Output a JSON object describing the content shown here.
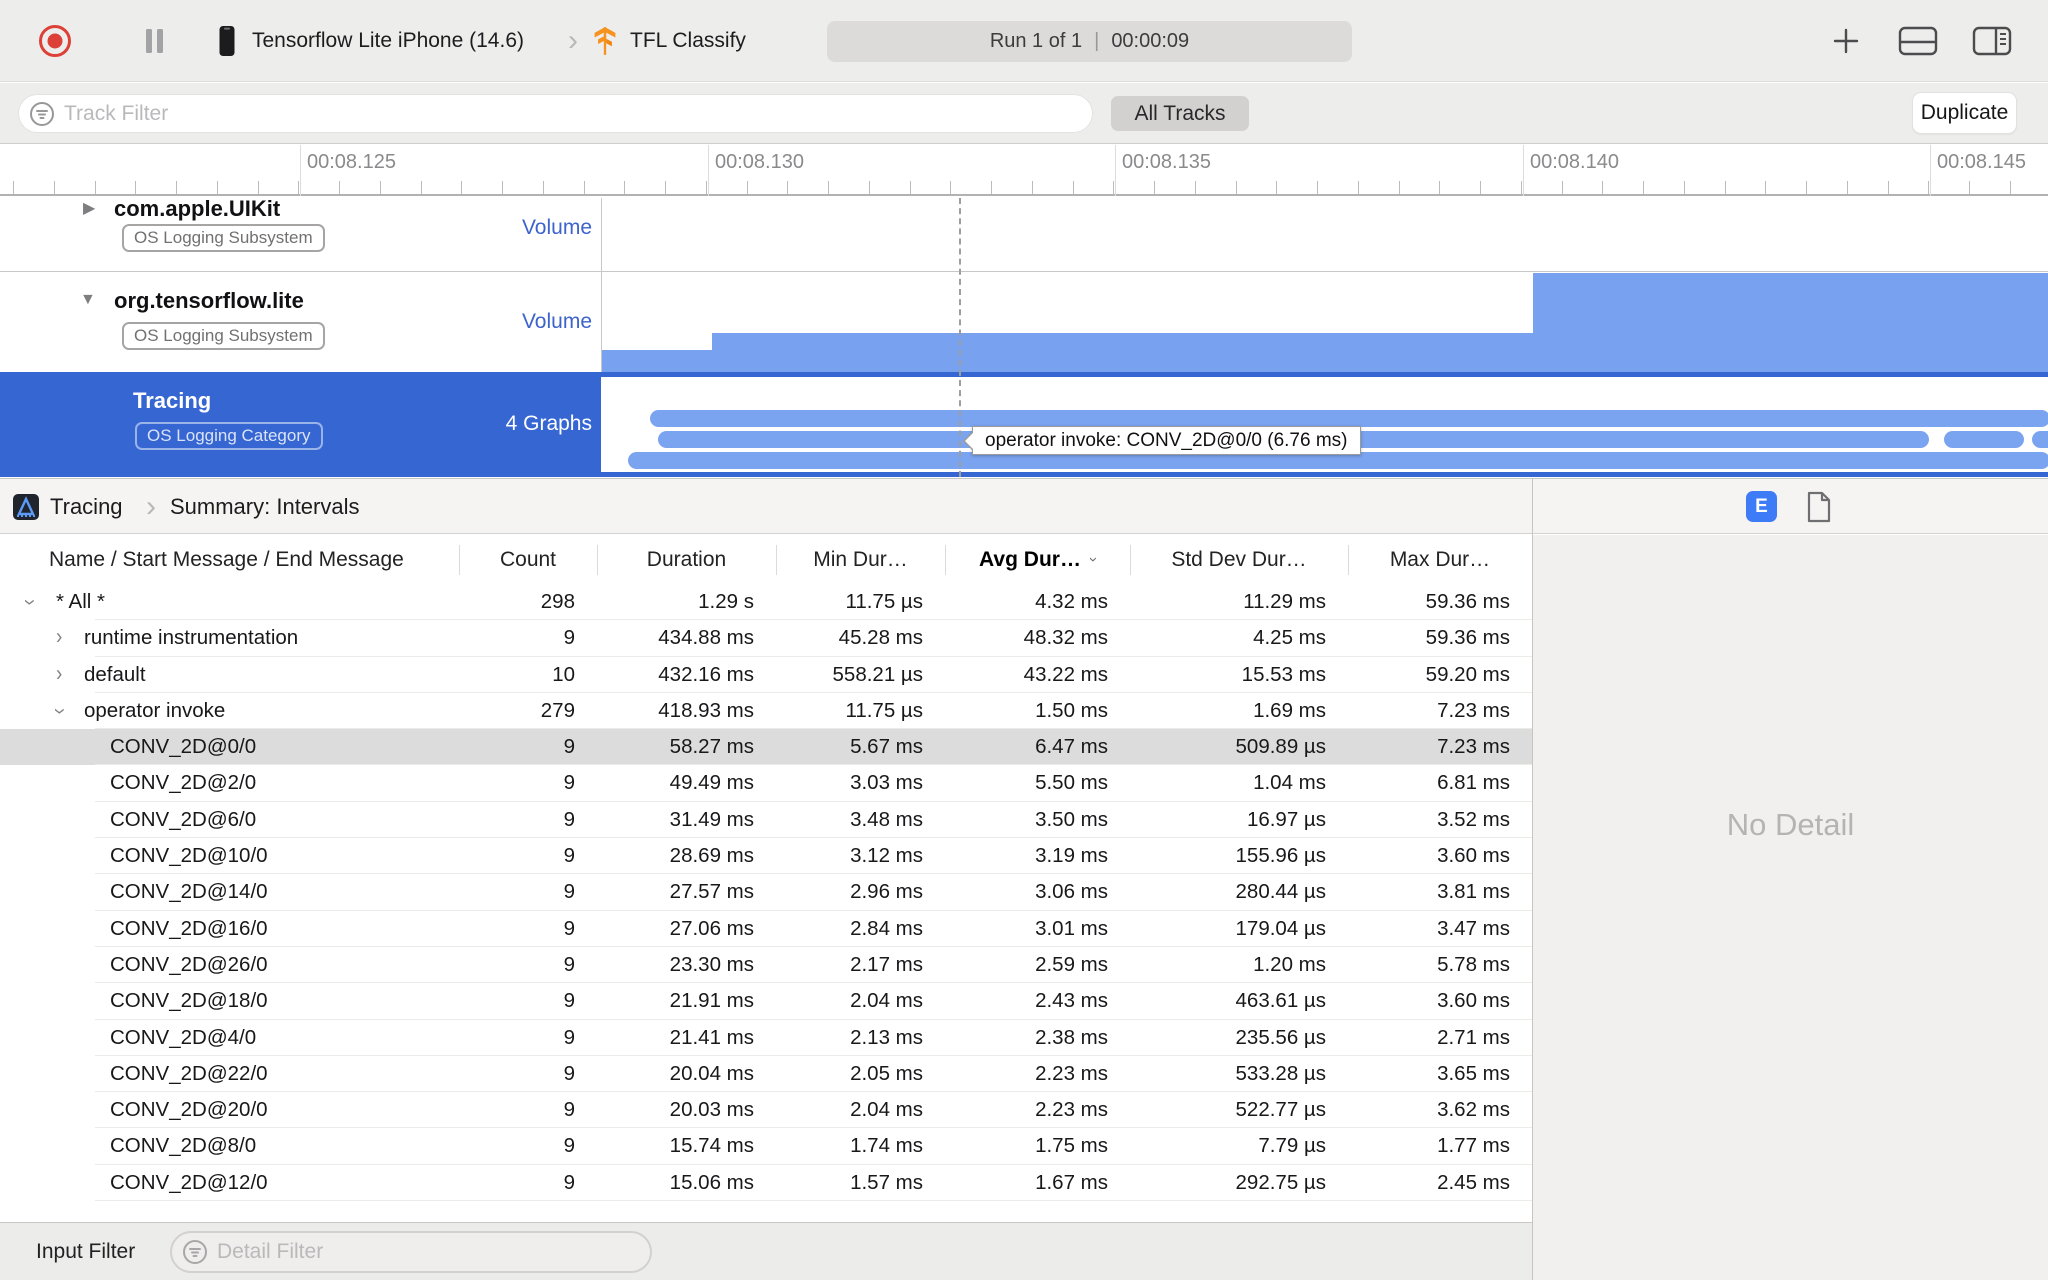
{
  "toolbar": {
    "device_breadcrumb": "Tensorflow Lite iPhone (14.6)",
    "target_app": "TFL Classify",
    "run_status": "Run 1 of 1",
    "run_separator": "|",
    "run_time": "00:00:09"
  },
  "filter_bar": {
    "track_filter_placeholder": "Track Filter",
    "all_tracks_label": "All Tracks",
    "duplicate_label": "Duplicate"
  },
  "ruler": {
    "labels": [
      "00:08.125",
      "00:08.130",
      "00:08.135",
      "00:08.140",
      "00:08.145"
    ]
  },
  "tracks": [
    {
      "title": "com.apple.UIKit",
      "badge": "OS Logging Subsystem",
      "meta": "Volume",
      "disclosure": "collapsed"
    },
    {
      "title": "org.tensorflow.lite",
      "badge": "OS Logging Subsystem",
      "meta": "Volume",
      "disclosure": "expanded"
    },
    {
      "title": "Tracing",
      "badge": "OS Logging Category",
      "meta": "4 Graphs",
      "disclosure": "none",
      "selected": true
    }
  ],
  "tooltip": {
    "text": "operator invoke: CONV_2D@0/0 (6.76 ms)"
  },
  "detail": {
    "breadcrumb": {
      "root": "Tracing",
      "page": "Summary: Intervals"
    },
    "view_toggle_label": "E",
    "no_detail": "No Detail",
    "bottom_label": "Input Filter",
    "bottom_placeholder": "Detail Filter"
  },
  "table": {
    "columns": [
      "Name / Start Message / End Message",
      "Count",
      "Duration",
      "Min Dur…",
      "Avg Dur…",
      "Std Dev Dur…",
      "Max Dur…"
    ],
    "sorted_column": "Avg Dur…",
    "rows": [
      {
        "level": 1,
        "disclosure": "expanded",
        "name": "* All *",
        "count": "298",
        "duration": "1.29 s",
        "min": "11.75 µs",
        "avg": "4.32 ms",
        "std": "11.29 ms",
        "max": "59.36 ms"
      },
      {
        "level": 2,
        "disclosure": "collapsed",
        "name": "runtime instrumentation",
        "count": "9",
        "duration": "434.88 ms",
        "min": "45.28 ms",
        "avg": "48.32 ms",
        "std": "4.25 ms",
        "max": "59.36 ms"
      },
      {
        "level": 2,
        "disclosure": "collapsed",
        "name": "default",
        "count": "10",
        "duration": "432.16 ms",
        "min": "558.21 µs",
        "avg": "43.22 ms",
        "std": "15.53 ms",
        "max": "59.20 ms"
      },
      {
        "level": 2,
        "disclosure": "expanded",
        "name": "operator invoke",
        "count": "279",
        "duration": "418.93 ms",
        "min": "11.75 µs",
        "avg": "1.50 ms",
        "std": "1.69 ms",
        "max": "7.23 ms"
      },
      {
        "level": 3,
        "disclosure": "none",
        "selected": true,
        "name": "CONV_2D@0/0",
        "count": "9",
        "duration": "58.27 ms",
        "min": "5.67 ms",
        "avg": "6.47 ms",
        "std": "509.89 µs",
        "max": "7.23 ms"
      },
      {
        "level": 3,
        "disclosure": "none",
        "name": "CONV_2D@2/0",
        "count": "9",
        "duration": "49.49 ms",
        "min": "3.03 ms",
        "avg": "5.50 ms",
        "std": "1.04 ms",
        "max": "6.81 ms"
      },
      {
        "level": 3,
        "disclosure": "none",
        "name": "CONV_2D@6/0",
        "count": "9",
        "duration": "31.49 ms",
        "min": "3.48 ms",
        "avg": "3.50 ms",
        "std": "16.97 µs",
        "max": "3.52 ms"
      },
      {
        "level": 3,
        "disclosure": "none",
        "name": "CONV_2D@10/0",
        "count": "9",
        "duration": "28.69 ms",
        "min": "3.12 ms",
        "avg": "3.19 ms",
        "std": "155.96 µs",
        "max": "3.60 ms"
      },
      {
        "level": 3,
        "disclosure": "none",
        "name": "CONV_2D@14/0",
        "count": "9",
        "duration": "27.57 ms",
        "min": "2.96 ms",
        "avg": "3.06 ms",
        "std": "280.44 µs",
        "max": "3.81 ms"
      },
      {
        "level": 3,
        "disclosure": "none",
        "name": "CONV_2D@16/0",
        "count": "9",
        "duration": "27.06 ms",
        "min": "2.84 ms",
        "avg": "3.01 ms",
        "std": "179.04 µs",
        "max": "3.47 ms"
      },
      {
        "level": 3,
        "disclosure": "none",
        "name": "CONV_2D@26/0",
        "count": "9",
        "duration": "23.30 ms",
        "min": "2.17 ms",
        "avg": "2.59 ms",
        "std": "1.20 ms",
        "max": "5.78 ms"
      },
      {
        "level": 3,
        "disclosure": "none",
        "name": "CONV_2D@18/0",
        "count": "9",
        "duration": "21.91 ms",
        "min": "2.04 ms",
        "avg": "2.43 ms",
        "std": "463.61 µs",
        "max": "3.60 ms"
      },
      {
        "level": 3,
        "disclosure": "none",
        "name": "CONV_2D@4/0",
        "count": "9",
        "duration": "21.41 ms",
        "min": "2.13 ms",
        "avg": "2.38 ms",
        "std": "235.56 µs",
        "max": "2.71 ms"
      },
      {
        "level": 3,
        "disclosure": "none",
        "name": "CONV_2D@22/0",
        "count": "9",
        "duration": "20.04 ms",
        "min": "2.05 ms",
        "avg": "2.23 ms",
        "std": "533.28 µs",
        "max": "3.65 ms"
      },
      {
        "level": 3,
        "disclosure": "none",
        "name": "CONV_2D@20/0",
        "count": "9",
        "duration": "20.03 ms",
        "min": "2.04 ms",
        "avg": "2.23 ms",
        "std": "522.77 µs",
        "max": "3.62 ms"
      },
      {
        "level": 3,
        "disclosure": "none",
        "name": "CONV_2D@8/0",
        "count": "9",
        "duration": "15.74 ms",
        "min": "1.74 ms",
        "avg": "1.75 ms",
        "std": "7.79 µs",
        "max": "1.77 ms"
      },
      {
        "level": 3,
        "disclosure": "none",
        "name": "CONV_2D@12/0",
        "count": "9",
        "duration": "15.06 ms",
        "min": "1.57 ms",
        "avg": "1.67 ms",
        "std": "292.75 µs",
        "max": "2.45 ms"
      }
    ]
  },
  "colors": {
    "selection_blue": "#3566d2",
    "graph_bar_blue": "#78a2ef",
    "volume_link_blue": "#3d63cc",
    "e_button_blue": "#3e7bf7",
    "record_red": "#dd4037",
    "selected_row_gray": "#dcdcdc",
    "tf_logo_orange": "#f6921e"
  }
}
